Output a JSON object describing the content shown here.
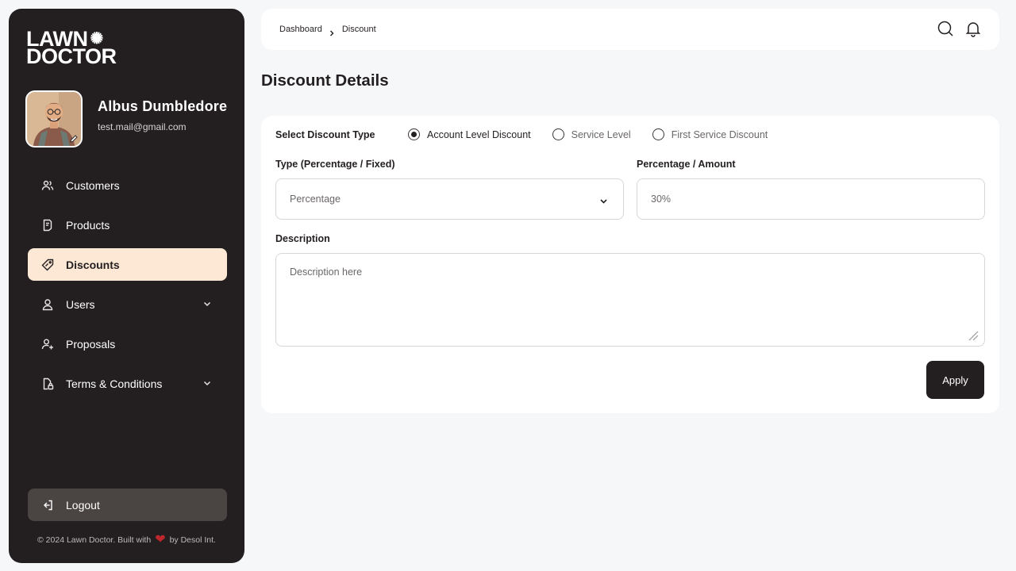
{
  "brand": {
    "line1": "LAWN",
    "line2": "DOCTOR",
    "mark": "✺"
  },
  "profile": {
    "name": "Albus Dumbledore",
    "email": "test.mail@gmail.com"
  },
  "nav": [
    {
      "label": "Customers",
      "icon": "users-icon"
    },
    {
      "label": "Products",
      "icon": "document-icon"
    },
    {
      "label": "Discounts",
      "icon": "tag-icon",
      "active": true
    },
    {
      "label": "Users",
      "icon": "user-icon",
      "expandable": true
    },
    {
      "label": "Proposals",
      "icon": "user-plus-icon"
    },
    {
      "label": "Terms & Conditions",
      "icon": "file-lock-icon",
      "expandable": true
    }
  ],
  "logout": {
    "label": "Logout"
  },
  "footer": {
    "before": "© 2024 Lawn Doctor. Built with",
    "after": "by Desol Int."
  },
  "breadcrumb": {
    "items": [
      "Dashboard",
      "Discount"
    ]
  },
  "page": {
    "title": "Discount Details"
  },
  "form": {
    "discount_type_label": "Select Discount Type",
    "discount_options": [
      {
        "label": "Account Level Discount",
        "selected": true
      },
      {
        "label": "Service Level",
        "selected": false
      },
      {
        "label": "First Service Discount",
        "selected": false
      }
    ],
    "type_label": "Type (Percentage / Fixed)",
    "type_value": "Percentage",
    "amount_label": "Percentage / Amount",
    "amount_placeholder": "30%",
    "description_label": "Description",
    "description_placeholder": "Description here",
    "apply_label": "Apply"
  },
  "colors": {
    "sidebar": "#231f20",
    "active_nav": "#fde8d5",
    "background": "#f6f7f9",
    "logout_bg": "#4a4443"
  }
}
